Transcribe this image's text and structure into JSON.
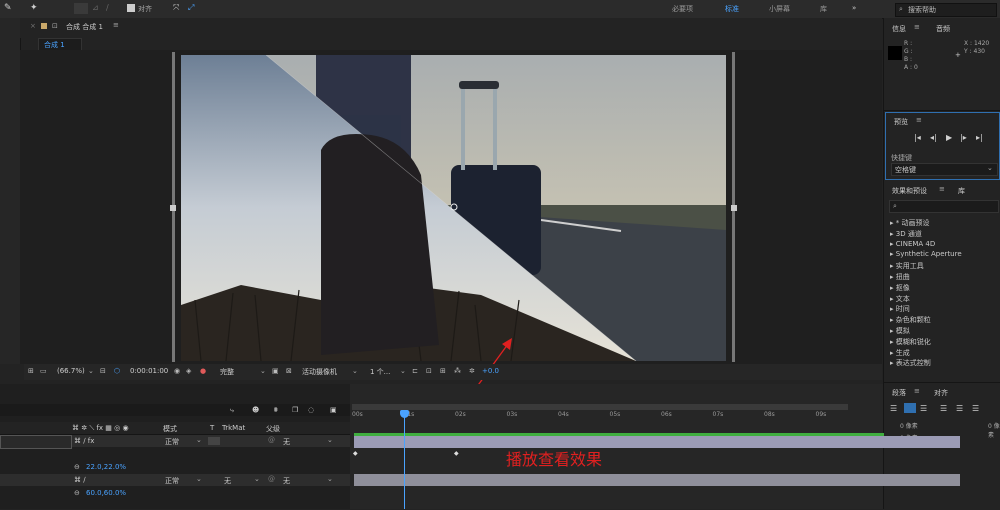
{
  "toolbar": {
    "snap_label": "对齐",
    "workspaces": [
      "必要项",
      "标准",
      "小屏幕",
      "库"
    ],
    "active_workspace": "标准",
    "search_placeholder": "搜索帮助"
  },
  "comp": {
    "panel_title": "合成 合成 1",
    "tab_label": "合成 1"
  },
  "viewer_bar": {
    "zoom": "(66.7%)",
    "timecode": "0:00:01:00",
    "resolution": "完整",
    "camera": "活动摄像机",
    "views": "1 个...",
    "exposure": "+0.0"
  },
  "info": {
    "tab_info": "信息",
    "tab_audio": "音频",
    "r": "R :",
    "g": "G :",
    "b": "B :",
    "a": "A : 0",
    "x": "X : 1420",
    "y": "Y : 430"
  },
  "preview": {
    "title": "预览",
    "shortcut_label": "快捷键",
    "shortcut_value": "空格键"
  },
  "effects": {
    "tab_label": "效果和预设",
    "tab_lib": "库",
    "items": [
      "* 动画预设",
      "3D 通道",
      "CINEMA 4D",
      "Synthetic Aperture",
      "实用工具",
      "扭曲",
      "抠像",
      "文本",
      "时间",
      "杂色和颗粒",
      "模拟",
      "模糊和锐化",
      "生成",
      "表达式控制"
    ]
  },
  "paragraph": {
    "tab_para": "段落",
    "tab_align": "对齐",
    "px1": "0 像素",
    "px2": "0 像素",
    "px3": "0 像素"
  },
  "timeline": {
    "col_mode": "模式",
    "col_t": "T",
    "col_trkmat": "TrkMat",
    "col_parent": "父级",
    "layer1_mode": "正常",
    "layer1_parent": "无",
    "layer1_scale": "22.0,22.0%",
    "layer2_mode": "正常",
    "layer2_trkmat": "无",
    "layer2_parent": "无",
    "layer2_scale": "60.0,60.0%",
    "ticks": [
      "00s",
      "01s",
      "02s",
      "03s",
      "04s",
      "05s",
      "06s",
      "07s",
      "08s",
      "09s"
    ],
    "annotation": "播放查看效果"
  },
  "colors": {
    "accent": "#4aa3ff",
    "annotation": "#e02020"
  }
}
